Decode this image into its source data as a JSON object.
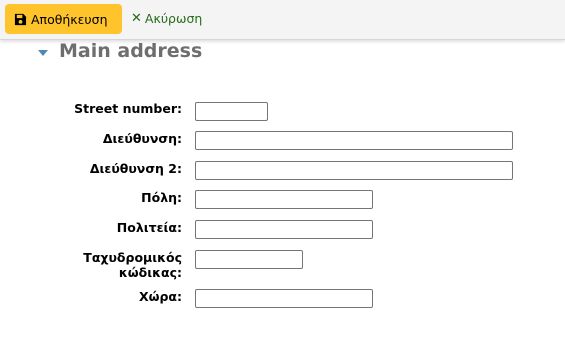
{
  "toolbar": {
    "save_label": "Αποθήκευση",
    "cancel_label": "Ακύρωση",
    "save_icon": "floppy-disk-icon",
    "cancel_icon": "x-icon",
    "save_color": "#ffc32b",
    "cancel_color": "#276b1c"
  },
  "section": {
    "title": "Main address",
    "toggle_icon": "caret-down-icon"
  },
  "fields": {
    "street_number": {
      "label": "Street number:",
      "value": ""
    },
    "address": {
      "label": "Διεύθυνση:",
      "value": ""
    },
    "address2": {
      "label": "Διεύθυνση 2:",
      "value": ""
    },
    "city": {
      "label": "Πόλη:",
      "value": ""
    },
    "state": {
      "label": "Πολιτεία:",
      "value": ""
    },
    "zipcode": {
      "label_line1": "Ταχυδρομικός",
      "label_line2": "κώδικας:",
      "value": ""
    },
    "country": {
      "label": "Χώρα:",
      "value": ""
    }
  }
}
